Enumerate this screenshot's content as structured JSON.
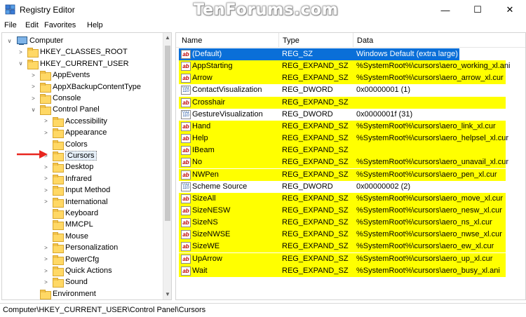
{
  "window": {
    "title": "Registry Editor",
    "watermark": "TenForums.com",
    "minimize_glyph": "—",
    "maximize_glyph": "☐",
    "close_glyph": "✕"
  },
  "menu": [
    "File",
    "Edit",
    "Favorites",
    "Help"
  ],
  "tree": [
    {
      "label": "Computer",
      "level": 0,
      "expander": "∨",
      "icon": "computer-icon"
    },
    {
      "label": "HKEY_CLASSES_ROOT",
      "level": 1,
      "expander": ">",
      "icon": "folder-icon"
    },
    {
      "label": "HKEY_CURRENT_USER",
      "level": 1,
      "expander": "∨",
      "icon": "folder-icon"
    },
    {
      "label": "AppEvents",
      "level": 2,
      "expander": ">",
      "icon": "folder-icon"
    },
    {
      "label": "AppXBackupContentType",
      "level": 2,
      "expander": ">",
      "icon": "folder-icon"
    },
    {
      "label": "Console",
      "level": 2,
      "expander": ">",
      "icon": "folder-icon"
    },
    {
      "label": "Control Panel",
      "level": 2,
      "expander": "∨",
      "icon": "folder-icon"
    },
    {
      "label": "Accessibility",
      "level": 3,
      "expander": ">",
      "icon": "folder-icon"
    },
    {
      "label": "Appearance",
      "level": 3,
      "expander": ">",
      "icon": "folder-icon"
    },
    {
      "label": "Colors",
      "level": 3,
      "expander": "",
      "icon": "folder-icon"
    },
    {
      "label": "Cursors",
      "level": 3,
      "expander": ">",
      "icon": "folder-icon",
      "selected": true
    },
    {
      "label": "Desktop",
      "level": 3,
      "expander": ">",
      "icon": "folder-icon"
    },
    {
      "label": "Infrared",
      "level": 3,
      "expander": ">",
      "icon": "folder-icon"
    },
    {
      "label": "Input Method",
      "level": 3,
      "expander": ">",
      "icon": "folder-icon"
    },
    {
      "label": "International",
      "level": 3,
      "expander": ">",
      "icon": "folder-icon"
    },
    {
      "label": "Keyboard",
      "level": 3,
      "expander": "",
      "icon": "folder-icon"
    },
    {
      "label": "MMCPL",
      "level": 3,
      "expander": "",
      "icon": "folder-icon"
    },
    {
      "label": "Mouse",
      "level": 3,
      "expander": "",
      "icon": "folder-icon"
    },
    {
      "label": "Personalization",
      "level": 3,
      "expander": ">",
      "icon": "folder-icon"
    },
    {
      "label": "PowerCfg",
      "level": 3,
      "expander": ">",
      "icon": "folder-icon"
    },
    {
      "label": "Quick Actions",
      "level": 3,
      "expander": ">",
      "icon": "folder-icon"
    },
    {
      "label": "Sound",
      "level": 3,
      "expander": ">",
      "icon": "folder-icon"
    },
    {
      "label": "Environment",
      "level": 2,
      "expander": "",
      "icon": "folder-icon"
    }
  ],
  "columns": {
    "name": "Name",
    "type": "Type",
    "data": "Data"
  },
  "values": [
    {
      "name": "(Default)",
      "type": "REG_SZ",
      "data": "Windows Default (extra large)",
      "icon": "string",
      "highlight": "selected"
    },
    {
      "name": "AppStarting",
      "type": "REG_EXPAND_SZ",
      "data": "%SystemRoot%\\cursors\\aero_working_xl.ani",
      "icon": "string",
      "highlight": "yellow"
    },
    {
      "name": "Arrow",
      "type": "REG_EXPAND_SZ",
      "data": "%SystemRoot%\\cursors\\aero_arrow_xl.cur",
      "icon": "string",
      "highlight": "yellow"
    },
    {
      "name": "ContactVisualization",
      "type": "REG_DWORD",
      "data": "0x00000001 (1)",
      "icon": "binary",
      "highlight": "none"
    },
    {
      "name": "Crosshair",
      "type": "REG_EXPAND_SZ",
      "data": "",
      "icon": "string",
      "highlight": "yellow"
    },
    {
      "name": "GestureVisualization",
      "type": "REG_DWORD",
      "data": "0x0000001f (31)",
      "icon": "binary",
      "highlight": "none"
    },
    {
      "name": "Hand",
      "type": "REG_EXPAND_SZ",
      "data": "%SystemRoot%\\cursors\\aero_link_xl.cur",
      "icon": "string",
      "highlight": "yellow"
    },
    {
      "name": "Help",
      "type": "REG_EXPAND_SZ",
      "data": "%SystemRoot%\\cursors\\aero_helpsel_xl.cur",
      "icon": "string",
      "highlight": "yellow"
    },
    {
      "name": "IBeam",
      "type": "REG_EXPAND_SZ",
      "data": "",
      "icon": "string",
      "highlight": "yellow"
    },
    {
      "name": "No",
      "type": "REG_EXPAND_SZ",
      "data": "%SystemRoot%\\cursors\\aero_unavail_xl.cur",
      "icon": "string",
      "highlight": "yellow"
    },
    {
      "name": "NWPen",
      "type": "REG_EXPAND_SZ",
      "data": "%SystemRoot%\\cursors\\aero_pen_xl.cur",
      "icon": "string",
      "highlight": "yellow"
    },
    {
      "name": "Scheme Source",
      "type": "REG_DWORD",
      "data": "0x00000002 (2)",
      "icon": "binary",
      "highlight": "none"
    },
    {
      "name": "SizeAll",
      "type": "REG_EXPAND_SZ",
      "data": "%SystemRoot%\\cursors\\aero_move_xl.cur",
      "icon": "string",
      "highlight": "yellow"
    },
    {
      "name": "SizeNESW",
      "type": "REG_EXPAND_SZ",
      "data": "%SystemRoot%\\cursors\\aero_nesw_xl.cur",
      "icon": "string",
      "highlight": "yellow"
    },
    {
      "name": "SizeNS",
      "type": "REG_EXPAND_SZ",
      "data": "%SystemRoot%\\cursors\\aero_ns_xl.cur",
      "icon": "string",
      "highlight": "yellow"
    },
    {
      "name": "SizeNWSE",
      "type": "REG_EXPAND_SZ",
      "data": "%SystemRoot%\\cursors\\aero_nwse_xl.cur",
      "icon": "string",
      "highlight": "yellow"
    },
    {
      "name": "SizeWE",
      "type": "REG_EXPAND_SZ",
      "data": "%SystemRoot%\\cursors\\aero_ew_xl.cur",
      "icon": "string",
      "highlight": "yellow"
    },
    {
      "name": "UpArrow",
      "type": "REG_EXPAND_SZ",
      "data": "%SystemRoot%\\cursors\\aero_up_xl.cur",
      "icon": "string",
      "highlight": "yellow"
    },
    {
      "name": "Wait",
      "type": "REG_EXPAND_SZ",
      "data": "%SystemRoot%\\cursors\\aero_busy_xl.ani",
      "icon": "string",
      "highlight": "yellow"
    }
  ],
  "colors": {
    "highlight": "#ffff00",
    "selection": "#0a6fd8",
    "pointer_arrow": "#e8261f"
  },
  "status": "Computer\\HKEY_CURRENT_USER\\Control Panel\\Cursors"
}
